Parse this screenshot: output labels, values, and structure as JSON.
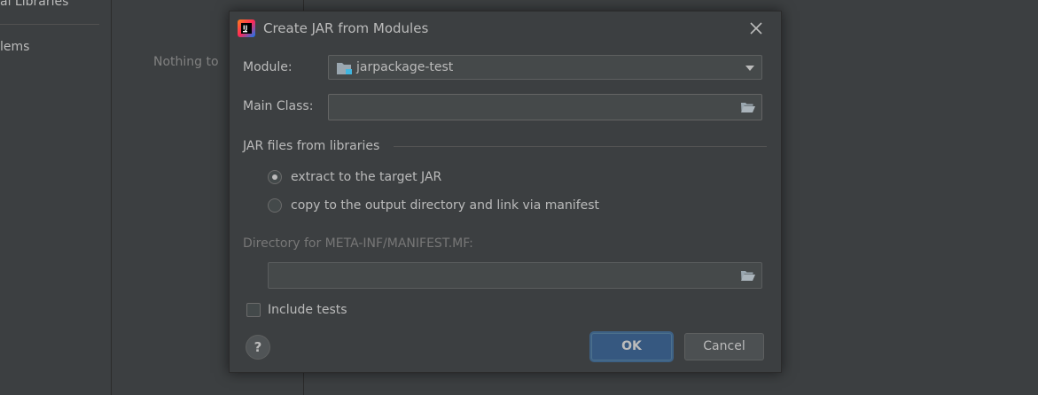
{
  "background": {
    "left_panel_items": [
      "al Libraries",
      "lems"
    ],
    "middle_panel_empty_text": "Nothing to"
  },
  "dialog": {
    "title": "Create JAR from Modules",
    "module": {
      "label": "Module:",
      "value": "jarpackage-test"
    },
    "main_class": {
      "label": "Main Class:",
      "value": ""
    },
    "jar_files_group": {
      "title": "JAR files from libraries",
      "options": [
        {
          "label": "extract to the target JAR",
          "selected": true
        },
        {
          "label": "copy to the output directory and link via manifest",
          "selected": false
        }
      ]
    },
    "manifest_dir": {
      "label": "Directory for META-INF/MANIFEST.MF:",
      "value": "",
      "enabled": false
    },
    "include_tests": {
      "label": "Include tests",
      "checked": false
    },
    "help_label": "?",
    "ok_label": "OK",
    "cancel_label": "Cancel"
  },
  "colors": {
    "background": "#3c3f41",
    "field": "#45494a",
    "primary_button": "#365880",
    "text": "#bbbbbb",
    "disabled_text": "#777777"
  },
  "icons": [
    "intellij-app-icon",
    "close-icon",
    "module-folder-icon",
    "dropdown-arrow-icon",
    "browse-folder-icon",
    "help-icon"
  ]
}
